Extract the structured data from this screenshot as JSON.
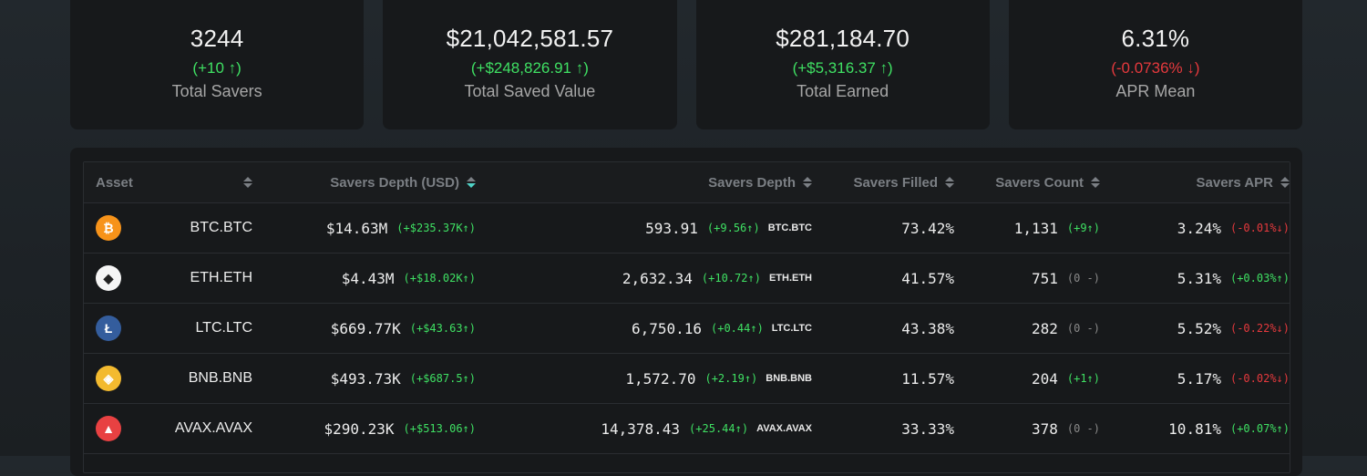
{
  "stats": [
    {
      "value": "3244",
      "delta": "(+10 ↑)",
      "delta_kind": "pos",
      "label": "Total Savers"
    },
    {
      "value": "$21,042,581.57",
      "delta": "(+$248,826.91 ↑)",
      "delta_kind": "pos",
      "label": "Total Saved Value"
    },
    {
      "value": "$281,184.70",
      "delta": "(+$5,316.37 ↑)",
      "delta_kind": "pos",
      "label": "Total Earned"
    },
    {
      "value": "6.31%",
      "delta": "(-0.0736% ↓)",
      "delta_kind": "neg",
      "label": "APR Mean"
    }
  ],
  "table": {
    "headers": {
      "asset": "Asset",
      "savers_depth_usd": "Savers Depth (USD)",
      "savers_depth": "Savers Depth",
      "savers_filled": "Savers Filled",
      "savers_count": "Savers Count",
      "savers_apr": "Savers APR"
    },
    "active_sort": "savers_depth_usd",
    "rows": [
      {
        "icon": "bitcoin-icon",
        "icon_color": "#f7931a",
        "icon_glyph": "₿",
        "asset": "BTC.BTC",
        "usd": "$14.63M",
        "usd_delta": "(+$235.37K↑)",
        "usd_kind": "pos",
        "depth": "593.91",
        "depth_delta": "(+9.56↑)",
        "depth_kind": "pos",
        "ticker": "BTC.BTC",
        "filled": "73.42%",
        "count": "1,131",
        "count_delta": "(+9↑)",
        "count_kind": "pos",
        "apr": "3.24%",
        "apr_delta": "(-0.01%↓)",
        "apr_kind": "neg"
      },
      {
        "icon": "ethereum-icon",
        "icon_color": "#f5f5f5",
        "icon_glyph": "◆",
        "asset": "ETH.ETH",
        "usd": "$4.43M",
        "usd_delta": "(+$18.02K↑)",
        "usd_kind": "pos",
        "depth": "2,632.34",
        "depth_delta": "(+10.72↑)",
        "depth_kind": "pos",
        "ticker": "ETH.ETH",
        "filled": "41.57%",
        "count": "751",
        "count_delta": "(0 -)",
        "count_kind": "neu",
        "apr": "5.31%",
        "apr_delta": "(+0.03%↑)",
        "apr_kind": "pos"
      },
      {
        "icon": "litecoin-icon",
        "icon_color": "#345d9d",
        "icon_glyph": "Ł",
        "asset": "LTC.LTC",
        "usd": "$669.77K",
        "usd_delta": "(+$43.63↑)",
        "usd_kind": "pos",
        "depth": "6,750.16",
        "depth_delta": "(+0.44↑)",
        "depth_kind": "pos",
        "ticker": "LTC.LTC",
        "filled": "43.38%",
        "count": "282",
        "count_delta": "(0 -)",
        "count_kind": "neu",
        "apr": "5.52%",
        "apr_delta": "(-0.22%↓)",
        "apr_kind": "neg"
      },
      {
        "icon": "binance-icon",
        "icon_color": "#f3ba2f",
        "icon_glyph": "◈",
        "asset": "BNB.BNB",
        "usd": "$493.73K",
        "usd_delta": "(+$687.5↑)",
        "usd_kind": "pos",
        "depth": "1,572.70",
        "depth_delta": "(+2.19↑)",
        "depth_kind": "pos",
        "ticker": "BNB.BNB",
        "filled": "11.57%",
        "count": "204",
        "count_delta": "(+1↑)",
        "count_kind": "pos",
        "apr": "5.17%",
        "apr_delta": "(-0.02%↓)",
        "apr_kind": "neg"
      },
      {
        "icon": "avalanche-icon",
        "icon_color": "#e84142",
        "icon_glyph": "▲",
        "asset": "AVAX.AVAX",
        "usd": "$290.23K",
        "usd_delta": "(+$513.06↑)",
        "usd_kind": "pos",
        "depth": "14,378.43",
        "depth_delta": "(+25.44↑)",
        "depth_kind": "pos",
        "ticker": "AVAX.AVAX",
        "filled": "33.33%",
        "count": "378",
        "count_delta": "(0 -)",
        "count_kind": "neu",
        "apr": "10.81%",
        "apr_delta": "(+0.07%↑)",
        "apr_kind": "pos"
      }
    ]
  },
  "colors": {
    "positive": "#3fe063",
    "negative": "#e5393d",
    "neutral": "#8a8a8a",
    "sort_active": "#4fd1c5"
  }
}
